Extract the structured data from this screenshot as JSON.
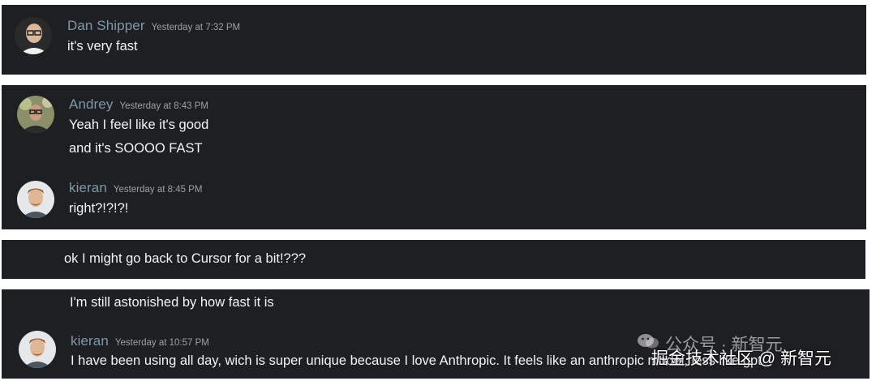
{
  "messages": {
    "m1": {
      "author": "Dan Shipper",
      "time": "Yesterday at 7:32 PM",
      "lines": [
        "it's very fast"
      ]
    },
    "m2": {
      "author": "Andrey",
      "time": "Yesterday at 8:43 PM",
      "lines": [
        "Yeah I feel like it's good",
        "and it's SOOOO FAST"
      ]
    },
    "m3": {
      "author": "kieran",
      "time": "Yesterday at 8:45 PM",
      "lines": [
        "right?!?!?!"
      ]
    },
    "m4": {
      "lines": [
        "ok I might go back to Cursor for a bit!???"
      ]
    },
    "m5": {
      "lines": [
        "I'm still astonished by how fast it is"
      ]
    },
    "m6": {
      "author": "kieran",
      "time": "Yesterday at 10:57 PM",
      "lines": [
        "I have been using all day, wich is super unique because I love Anthropic. It feels like an anthropic model, less like gpt"
      ]
    }
  },
  "watermark": {
    "line1": "公众号 · 新智元",
    "line2": "掘金技术社区 @ 新智元"
  },
  "colors": {
    "panel": "#1e1f22",
    "author": "#7f98a8",
    "timestamp": "#9ca0a6",
    "text": "#f2f3f5"
  }
}
